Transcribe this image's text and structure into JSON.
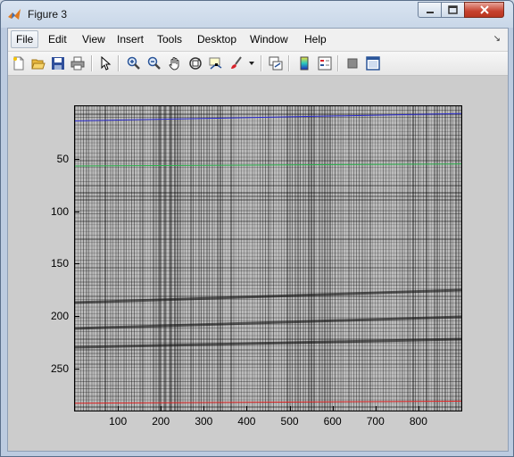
{
  "window": {
    "title": "Figure 3"
  },
  "menu": {
    "items": [
      "File",
      "Edit",
      "View",
      "Insert",
      "Tools",
      "Desktop",
      "Window",
      "Help"
    ]
  },
  "toolbar": {
    "buttons": [
      "new-figure",
      "open-file",
      "save-figure",
      "print-figure",
      "edit-plot",
      "zoom-in",
      "zoom-out",
      "pan",
      "rotate-3d",
      "data-cursor",
      "brush",
      "brush-menu",
      "link-plot",
      "insert-colorbar",
      "insert-legend",
      "hide-plot-tools",
      "show-plot-tools"
    ]
  },
  "plot": {
    "yticks": [
      "50",
      "100",
      "150",
      "200",
      "250"
    ],
    "xticks": [
      "100",
      "200",
      "300",
      "400",
      "500",
      "600",
      "700",
      "800"
    ],
    "line_colors": {
      "blue": "#2b2bd0",
      "green": "#29b14a",
      "red": "#e02020"
    }
  },
  "chart_data": {
    "type": "line",
    "description_source": "grayscale image with overlaid lines",
    "xlim": [
      0,
      900
    ],
    "ylim": [
      0,
      290
    ],
    "y_reversed": true,
    "x_ticks": [
      100,
      200,
      300,
      400,
      500,
      600,
      700,
      800
    ],
    "y_ticks": [
      50,
      100,
      150,
      200,
      250
    ],
    "series": [
      {
        "color": "blue",
        "x": [
          0,
          900
        ],
        "y": [
          14,
          7
        ]
      },
      {
        "color": "green",
        "x": [
          0,
          900
        ],
        "y": [
          57,
          55
        ]
      },
      {
        "color": "red",
        "x": [
          0,
          900
        ],
        "y": [
          283,
          281
        ]
      }
    ]
  }
}
